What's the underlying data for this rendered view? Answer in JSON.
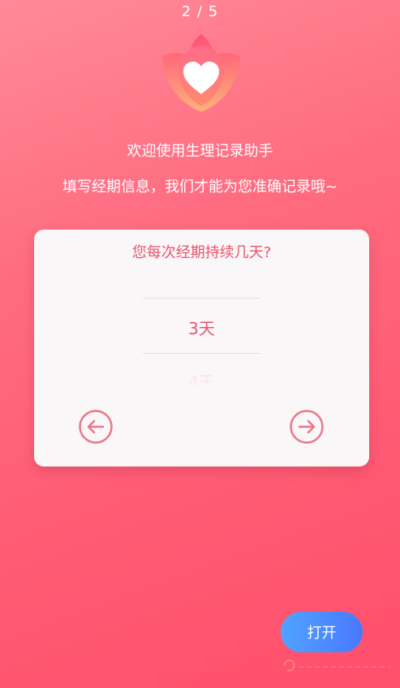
{
  "header": {
    "step": "2 / 5"
  },
  "intro": {
    "welcome": "欢迎使用生理记录助手",
    "subtitle": "填写经期信息，我们才能为您准确记录哦~"
  },
  "card": {
    "question": "您每次经期持续几天?",
    "picker": {
      "selected": "3天",
      "next": "4天"
    },
    "prev_icon": "arrow-left-circle-icon",
    "next_icon": "arrow-right-circle-icon"
  },
  "footer": {
    "open_label": "打开"
  },
  "colors": {
    "accent": "#e8556b",
    "button": "#4a78ff"
  }
}
